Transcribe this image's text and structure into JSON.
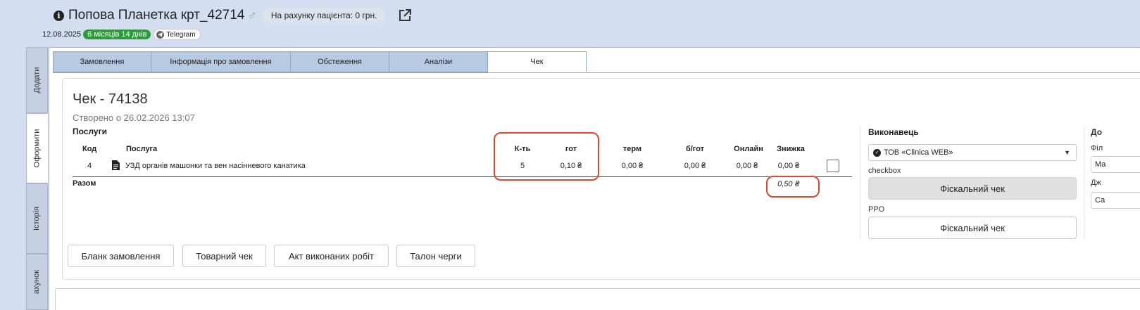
{
  "header": {
    "patient_name": "Попова Планетка крт_42714",
    "gender_symbol": "♂",
    "balance_badge": "На рахунку пацієнта: 0 грн.",
    "date": "12.08.2025",
    "age": "6 місяців 14 днів",
    "telegram": "Telegram"
  },
  "side_tabs": [
    "Додати",
    "Оформити",
    "Історія",
    "ахунок"
  ],
  "tabs": [
    "Замовлення",
    "Інформація про замовлення",
    "Обстеження",
    "Аналізи",
    "Чек"
  ],
  "receipt": {
    "title": "Чек - 74138",
    "created": "Створено о 26.02.2026 13:07",
    "services_heading": "Послуги",
    "columns": {
      "code": "Код",
      "service": "Послуга",
      "qty": "К-ть",
      "cash": "гот",
      "term": "терм",
      "noncash": "б/гот",
      "online": "Онлайн",
      "discount": "Знижка"
    },
    "rows": [
      {
        "code": "4",
        "service": "УЗД органів машонки та вен насінневого канатика",
        "qty": "5",
        "cash": "0,10 ₴",
        "term": "0,00 ₴",
        "noncash": "0,00 ₴",
        "online": "0,00 ₴",
        "discount": "0,00 ₴"
      }
    ],
    "total_label": "Разом",
    "total_value": "0,50 ₴"
  },
  "executor": {
    "heading": "Виконавець",
    "selected": "ТОВ «Clinica WEB»",
    "checkbox_label": "checkbox",
    "fiscal_btn_1": "Фіскальний чек",
    "ppo_label": "PPO",
    "fiscal_btn_2": "Фіскальний чек"
  },
  "cut_off": {
    "heading": "До",
    "label1": "Філ",
    "box1": "Ма",
    "label2": "Дж",
    "box2": "Са"
  },
  "bottom_buttons": {
    "order_form": "Бланк замовлення",
    "goods_receipt": "Товарний чек",
    "work_act": "Акт виконаних робіт",
    "queue_ticket": "Талон черги"
  },
  "colors": {
    "highlight": "#e0452e",
    "age_badge": "#2e9a3c",
    "tab_bg": "#b8c9e2",
    "page_bg": "#d3dff0"
  }
}
